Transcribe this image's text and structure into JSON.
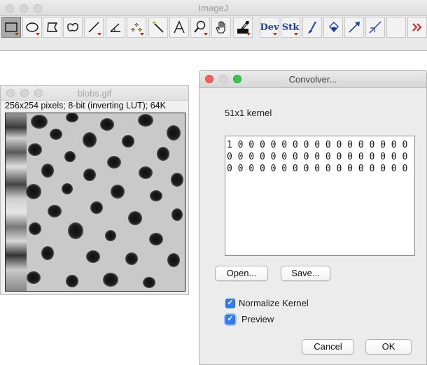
{
  "imagej": {
    "title": "ImageJ"
  },
  "toolbar": {
    "tools": [
      {
        "name": "rectangle-tool-icon",
        "selected": true,
        "menu": true
      },
      {
        "name": "oval-tool-icon",
        "menu": true
      },
      {
        "name": "polygon-tool-icon"
      },
      {
        "name": "freehand-tool-icon"
      },
      {
        "name": "line-tool-icon",
        "menu": true
      },
      {
        "name": "angle-tool-icon"
      },
      {
        "name": "point-tool-icon",
        "menu": true
      },
      {
        "name": "wand-tool-icon"
      },
      {
        "name": "text-tool-icon"
      },
      {
        "name": "magnifier-tool-icon",
        "menu": true
      },
      {
        "name": "hand-tool-icon"
      },
      {
        "name": "color-picker-tool-icon",
        "menu": true
      },
      {
        "name": "dev-menu",
        "label": "Dev",
        "menu": true
      },
      {
        "name": "stk-menu",
        "label": "Stk",
        "menu": true
      },
      {
        "name": "brush-tool-icon"
      },
      {
        "name": "flood-fill-tool-icon"
      },
      {
        "name": "arrow-tool-icon"
      },
      {
        "name": "pencil-tool-icon"
      },
      {
        "name": "more-tools-icon"
      }
    ]
  },
  "blobs": {
    "title": "blobs.gif",
    "info": "256x254 pixels; 8-bit (inverting LUT); 64K"
  },
  "convolver": {
    "title": "Convolver...",
    "kernel_label": "51x1 kernel",
    "kernel_text": "1 0 0 0 0 0 0 0 0 0 0 0 0 0 0 0 0 0 0 0 0 0 0 0 0 0 0 0 0 0 0 0 0 0 0 0 0 0 0 0 0 0 0 0 0 0 0 0 0 0 0",
    "open_label": "Open...",
    "save_label": "Save...",
    "normalize_label": "Normalize Kernel",
    "normalize_checked": true,
    "preview_label": "Preview",
    "preview_checked": true,
    "cancel_label": "Cancel",
    "ok_label": "OK"
  },
  "colors": {
    "accent": "#2f7cf6",
    "tool_text": "#1e3ea8",
    "menu_triangle": "#d02020"
  }
}
